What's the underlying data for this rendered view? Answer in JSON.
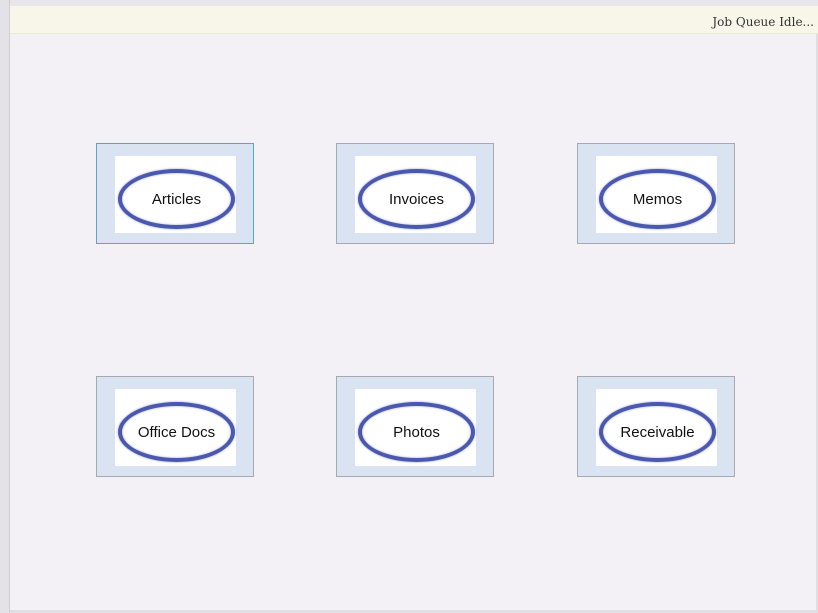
{
  "status": {
    "text": "Job Queue Idle..."
  },
  "tiles": [
    {
      "label": "Articles",
      "selected": true
    },
    {
      "label": "Invoices",
      "selected": false
    },
    {
      "label": "Memos",
      "selected": false
    },
    {
      "label": "Office Docs",
      "selected": false
    },
    {
      "label": "Photos",
      "selected": false
    },
    {
      "label": "Receivable",
      "selected": false
    }
  ],
  "colors": {
    "background": "#f3f1f5",
    "tile_background": "#d9e3f1",
    "ellipse_stroke": "#4a58b0",
    "selected_border": "#5aa8c0",
    "status_bar": "#f8f6e8"
  }
}
